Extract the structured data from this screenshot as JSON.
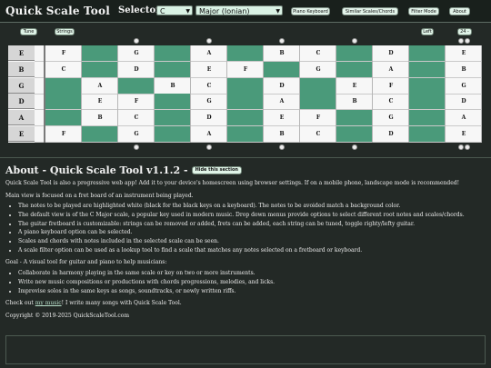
{
  "app": {
    "title": "Quick Scale Tool",
    "mode_label": "Selector Mode"
  },
  "selects": {
    "root": "C",
    "scale": "Major (Ionian)"
  },
  "toolbar": {
    "piano": "Piano Keyboard",
    "similar": "Similar Scales/Chords",
    "filter": "Filter Mode",
    "about": "About"
  },
  "fretbar": {
    "tune": "Tune",
    "strings": "Strings",
    "left": "Left",
    "frets": "24 -"
  },
  "strings": [
    "E",
    "B",
    "G",
    "D",
    "A",
    "E"
  ],
  "fret_notes": [
    [
      "F",
      "",
      "G",
      "",
      "A",
      "",
      "B",
      "C",
      "",
      "D",
      "",
      "E"
    ],
    [
      "C",
      "",
      "D",
      "",
      "E",
      "F",
      "",
      "G",
      "",
      "A",
      "",
      "B"
    ],
    [
      "",
      "A",
      "",
      "B",
      "C",
      "",
      "D",
      "",
      "E",
      "F",
      "",
      "G"
    ],
    [
      "",
      "E",
      "F",
      "",
      "G",
      "",
      "A",
      "",
      "B",
      "C",
      "",
      "D"
    ],
    [
      "",
      "B",
      "C",
      "",
      "D",
      "",
      "E",
      "F",
      "",
      "G",
      "",
      "A"
    ],
    [
      "F",
      "",
      "G",
      "",
      "A",
      "",
      "B",
      "C",
      "",
      "D",
      "",
      "E"
    ]
  ],
  "about": {
    "heading": "About - Quick Scale Tool v1.1.2 -",
    "hide_label": "Hide this section",
    "intro": "Quick Scale Tool is also a progressive web app! Add it to your device's homescreen using browser settings. If on a mobile phone, landscape mode is recommended!",
    "main": "Main view is focused on a fret board of an instrument being played.",
    "bullets1": [
      "The notes to be played are highlighted white (black for the black keys on a keyboard). The notes to be avoided match a background color.",
      "The default view is of the C Major scale, a popular key used in modern music. Drop down menus provide options to select different root notes and scales/chords.",
      "The guitar fretboard is customizable: strings can be removed or added, frets can be added, each string can be tuned, toggle righty/lefty guitar.",
      "A piano keyboard option can be selected.",
      "Scales and chords with notes included in the selected scale can be seen.",
      "A scale filter option can be used as a lookup tool to find a scale that matches any notes selected on a fretboard or keyboard."
    ],
    "goal": "Goal - A visual tool for guitar and piano to help musicians:",
    "bullets2": [
      "Collaborate in harmony playing in the same scale or key on two or more instruments.",
      "Write new music compositions or productions with chords progressions, melodies, and licks.",
      "Improvise solos in the same keys as songs, soundtracks, or newly written riffs."
    ],
    "checkout_pre": "Check out ",
    "checkout_link": "my music",
    "checkout_post": "! I write many songs with Quick Scale Tool.",
    "copyright": "Copyright © 2019-2025 QuickScaleTool.com"
  }
}
